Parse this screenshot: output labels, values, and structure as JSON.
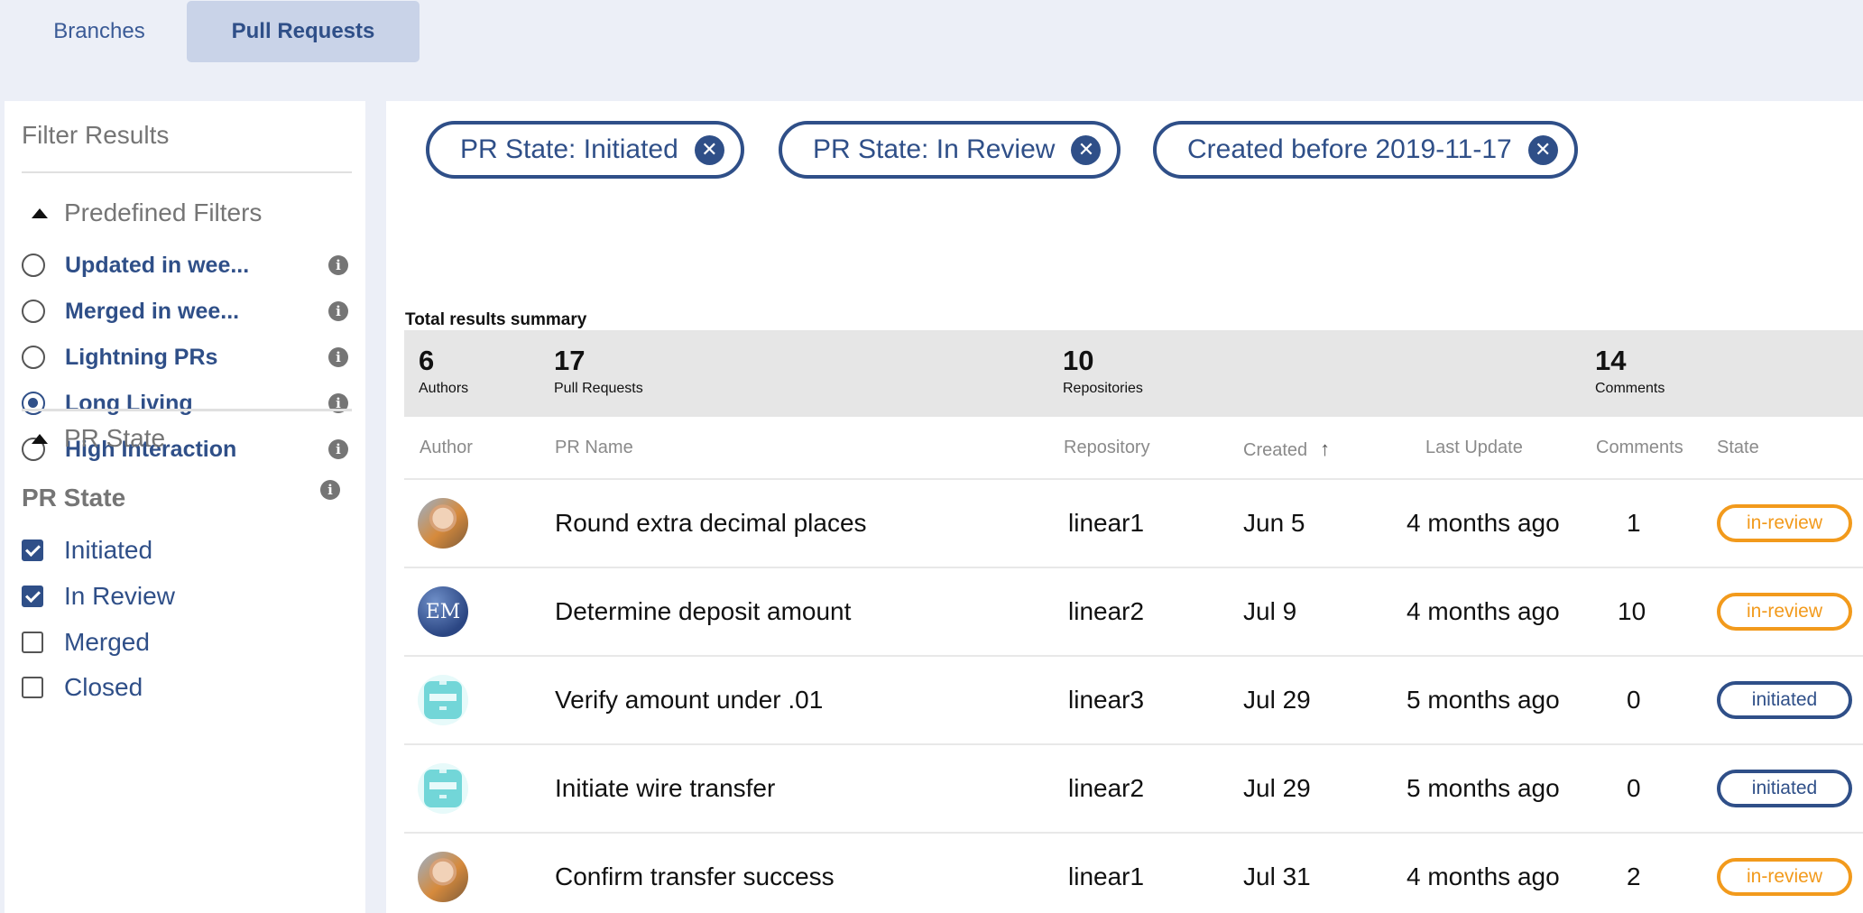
{
  "tabs": [
    {
      "label": "Branches"
    },
    {
      "label": "Pull Requests"
    }
  ],
  "filter_panel": {
    "title": "Filter Results",
    "predefined_header": "Predefined Filters",
    "predefined": [
      {
        "label": "Updated in wee...",
        "selected": false
      },
      {
        "label": "Merged in wee...",
        "selected": false
      },
      {
        "label": "Lightning PRs",
        "selected": false
      },
      {
        "label": "Long Living",
        "selected": true
      },
      {
        "label": "High Interaction",
        "selected": false
      }
    ],
    "pr_state_header": "PR State",
    "pr_state_title": "PR State",
    "states": [
      {
        "label": "Initiated",
        "checked": true
      },
      {
        "label": "In Review",
        "checked": true
      },
      {
        "label": "Merged",
        "checked": false
      },
      {
        "label": "Closed",
        "checked": false
      }
    ],
    "info_glyph": "i"
  },
  "chips": [
    {
      "label": "PR State: Initiated"
    },
    {
      "label": "PR State: In Review"
    },
    {
      "label": "Created before 2019-11-17"
    }
  ],
  "chip_close_glyph": "✕",
  "summary": {
    "title": "Total results summary",
    "stats": [
      {
        "value": "6",
        "label": "Authors"
      },
      {
        "value": "17",
        "label": "Pull Requests"
      },
      {
        "value": "10",
        "label": "Repositories"
      },
      {
        "value": "14",
        "label": "Comments"
      }
    ]
  },
  "table": {
    "headers": {
      "author": "Author",
      "name": "PR Name",
      "repository": "Repository",
      "created": "Created",
      "last_update": "Last Update",
      "comments": "Comments",
      "state": "State"
    },
    "sort_arrow": "↑",
    "rows": [
      {
        "avatar": "photo-avatar",
        "name": "Round extra decimal places",
        "repository": "linear1",
        "created": "Jun 5",
        "last_update": "4 months ago",
        "comments": "1",
        "state": "in-review"
      },
      {
        "avatar": "em-avatar",
        "avatar_text": "EM",
        "name": "Determine deposit amount",
        "repository": "linear2",
        "created": "Jul 9",
        "last_update": "4 months ago",
        "comments": "10",
        "state": "in-review"
      },
      {
        "avatar": "bot-avatar",
        "name": "Verify amount under .01",
        "repository": "linear3",
        "created": "Jul 29",
        "last_update": "5 months ago",
        "comments": "0",
        "state": "initiated"
      },
      {
        "avatar": "bot-avatar",
        "name": "Initiate wire transfer",
        "repository": "linear2",
        "created": "Jul 29",
        "last_update": "5 months ago",
        "comments": "0",
        "state": "initiated"
      },
      {
        "avatar": "photo-avatar",
        "name": "Confirm transfer success",
        "repository": "linear1",
        "created": "Jul 31",
        "last_update": "4 months ago",
        "comments": "2",
        "state": "in-review"
      }
    ]
  },
  "colors": {
    "accent": "#2f4f88",
    "in_review": "#f29a1c",
    "background": "#eceff7",
    "summary_bg": "#e6e6e6"
  }
}
